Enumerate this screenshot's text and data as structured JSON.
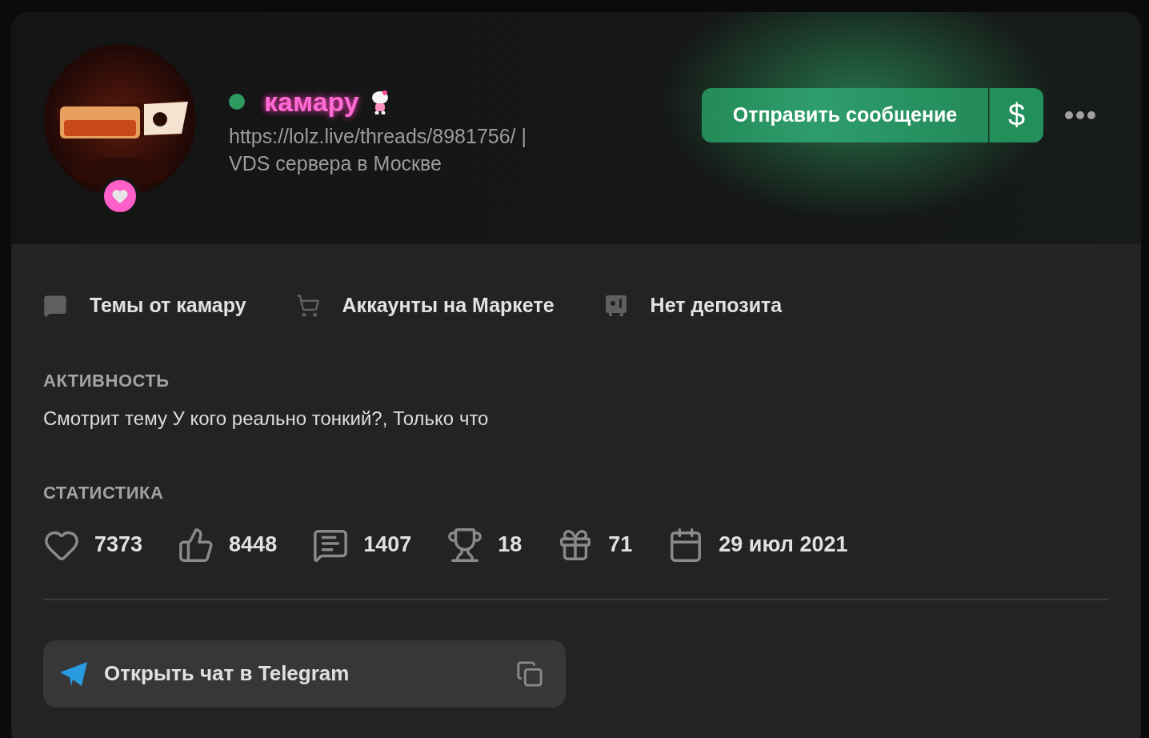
{
  "profile": {
    "online": true,
    "username": "камару",
    "status_text": "https://lolz.live/threads/8981756/ | VDS сервера в Москве"
  },
  "actions": {
    "message_button": "Отправить сообщение",
    "money_button": "$"
  },
  "links": [
    {
      "kind": "threads",
      "label": "Темы от камару"
    },
    {
      "kind": "market",
      "label": "Аккаунты на Маркете"
    },
    {
      "kind": "deposit",
      "label": "Нет депозита"
    }
  ],
  "activity": {
    "heading": "АКТИВНОСТЬ",
    "text": "Смотрит тему У кого реально тонкий?, Только что"
  },
  "stats": {
    "heading": "СТАТИСТИКА",
    "items": [
      {
        "kind": "likes",
        "value": "7373"
      },
      {
        "kind": "thumbs",
        "value": "8448"
      },
      {
        "kind": "messages",
        "value": "1407"
      },
      {
        "kind": "trophies",
        "value": "18"
      },
      {
        "kind": "gifts",
        "value": "71"
      },
      {
        "kind": "registered",
        "value": "29 июл 2021"
      }
    ]
  },
  "telegram": {
    "label": "Открыть чат в Telegram"
  }
}
